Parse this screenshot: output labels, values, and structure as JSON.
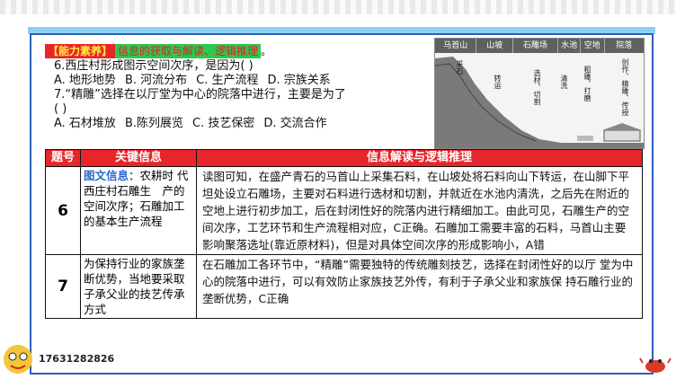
{
  "header": {
    "tag": "【能力素养】",
    "tag_text": "信息的获取与解读、逻辑推理",
    "period": "。"
  },
  "questions": {
    "q6": "6.西庄村形成图示空间次序，是因为(        )",
    "q6_options": [
      "A. 地形地势",
      "B. 河流分布",
      "C. 生产流程",
      "D. 宗族关系"
    ],
    "q7_line1": "7.“精雕”选择在以厅堂为中心的院落中进行，主要是为了",
    "q7_line2": "(        )",
    "q7_options": [
      "A. 石材堆放",
      "B.陈列展览",
      "C. 技艺保密",
      "D. 交流合作"
    ]
  },
  "figure": {
    "zones": [
      "马首山",
      "山坡",
      "石雕场",
      "水池",
      "空地",
      "院落"
    ],
    "labels": [
      "采石",
      "转运",
      "选材、切割",
      "清洗",
      "粗雕、打磨",
      "创作、精雕、传授"
    ]
  },
  "table": {
    "headers": [
      "题号",
      "关键信息",
      "信息解读与逻辑推理"
    ],
    "rows": [
      {
        "num": "6",
        "key_prefix": "图文信息：",
        "key": "农耕时 代西庄村石雕生　产的空间次序；石雕加工的基本生产流程",
        "analysis": "读图可知，在盛产青石的马首山上采集石料，在山坡处将石料向山下转运，在山脚下平坦处设立石雕场，主要对石料进行选材和切割，并就近在水池内清洗，之后先在附近的空地上进行初步加工，后在封闭性好的院落内进行精细加工。由此可见，石雕生产的空间次序，工艺环节和生产流程相对应，C正确。石雕加工需要丰富的石料，马首山主要影响聚落选址(靠近原材料)，但是对具体空间次序的形成影响小，A错"
      },
      {
        "num": "7",
        "key_prefix": "",
        "key": "为保持行业的家族垄断优势，当地要采取子承父业的技艺传承方式",
        "analysis": "在石雕加工各环节中，“精雕”需要独特的传统雕刻技艺，选择在封闭性好的以厅 堂为中心的院落中进行，可以有效防止家族技艺外传，有利于子承父业和家族保 持石雕行业的垄断优势，C正确"
      }
    ]
  },
  "footer": {
    "phone": "17631282826"
  },
  "colors": {
    "accent_red": "#e8252a",
    "border_blue": "#2b5fb8",
    "key_blue": "#2a6ad0"
  }
}
